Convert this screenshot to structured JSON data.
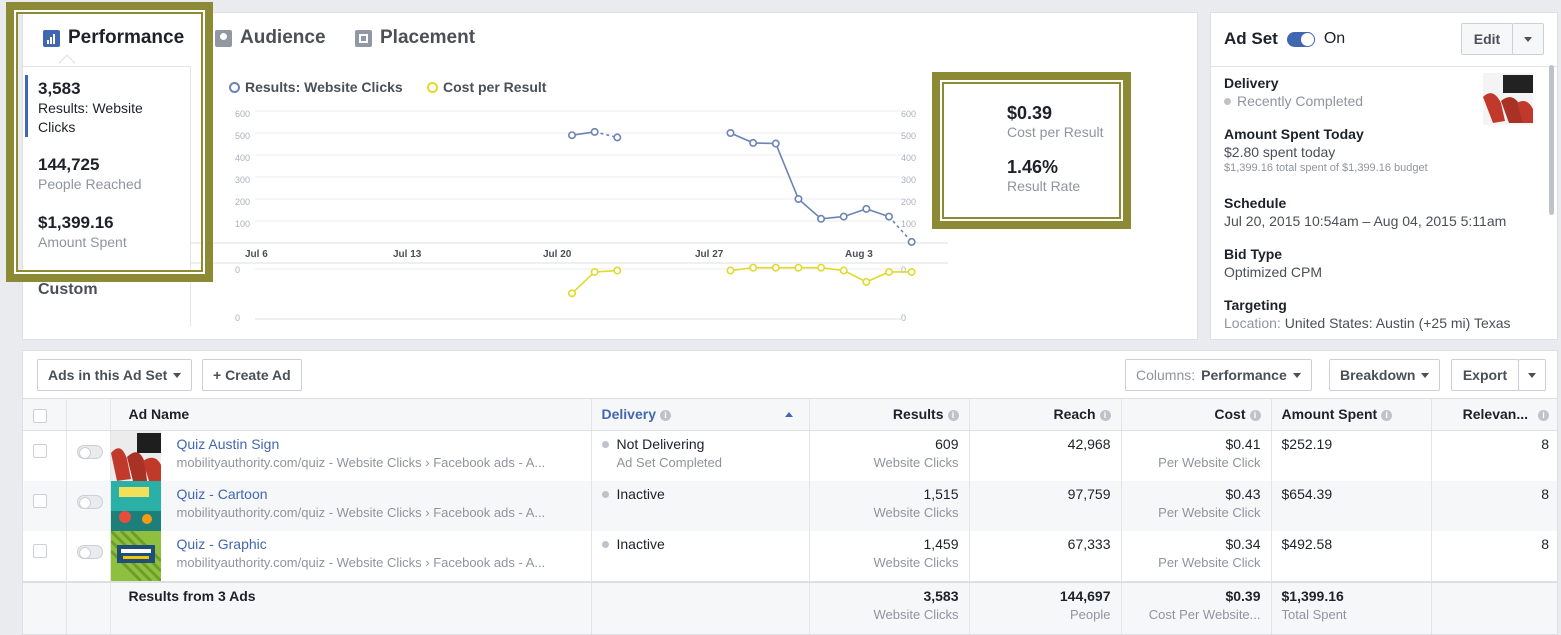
{
  "tabs": [
    {
      "label": "Performance",
      "icon": "bar-chart-icon",
      "active": true
    },
    {
      "label": "Audience",
      "icon": "audience-icon",
      "active": false
    },
    {
      "label": "Placement",
      "icon": "placement-icon",
      "active": false
    }
  ],
  "left_stats": [
    {
      "value": "3,583",
      "label": "Results: Website Clicks"
    },
    {
      "value": "144,725",
      "label": "People Reached"
    },
    {
      "value": "$1,399.16",
      "label": "Amount Spent"
    }
  ],
  "custom_label": "Custom",
  "chart_data": {
    "type": "line",
    "legend": [
      "Results: Website Clicks",
      "Cost per Result"
    ],
    "x_ticks": [
      "Jul 6",
      "Jul 13",
      "Jul 20",
      "Jul 27",
      "Aug 3"
    ],
    "y_ticks": [
      "600",
      "500",
      "400",
      "300",
      "200",
      "100"
    ],
    "lower_ticks": [
      "0",
      "0"
    ],
    "series": [
      {
        "name": "Results: Website Clicks",
        "color": "#6b84b5",
        "points": [
          [
            "Jul 20",
            490
          ],
          [
            "Jul 21",
            505
          ],
          [
            "Jul 22",
            480
          ],
          [
            "Jul 27",
            500
          ],
          [
            "Jul 28",
            455
          ],
          [
            "Jul 29",
            452
          ],
          [
            "Jul 30",
            200
          ],
          [
            "Jul 31",
            110
          ],
          [
            "Aug 1",
            120
          ],
          [
            "Aug 2",
            155
          ],
          [
            "Aug 3",
            120
          ],
          [
            "Aug 4",
            5
          ]
        ]
      },
      {
        "name": "Cost per Result",
        "color": "#e1d92c",
        "points": [
          [
            "Jul 20",
            0.18
          ],
          [
            "Jul 21",
            0.33
          ],
          [
            "Jul 22",
            0.34
          ],
          [
            "Jul 27",
            0.34
          ],
          [
            "Jul 28",
            0.36
          ],
          [
            "Jul 29",
            0.36
          ],
          [
            "Jul 30",
            0.36
          ],
          [
            "Jul 31",
            0.36
          ],
          [
            "Aug 1",
            0.34
          ],
          [
            "Aug 2",
            0.26
          ],
          [
            "Aug 3",
            0.33
          ],
          [
            "Aug 4",
            0.33
          ]
        ]
      }
    ]
  },
  "summary": [
    {
      "value": "$0.39",
      "label": "Cost per Result"
    },
    {
      "value": "1.46%",
      "label": "Result Rate"
    }
  ],
  "adset": {
    "title": "Ad Set",
    "status": "On",
    "edit_label": "Edit",
    "delivery": {
      "heading": "Delivery",
      "value": "Recently Completed"
    },
    "amount_spent_today": {
      "heading": "Amount Spent Today",
      "value": "$2.80 spent today",
      "detail": "$1,399.16 total spent of $1,399.16 budget"
    },
    "schedule": {
      "heading": "Schedule",
      "value": "Jul 20, 2015 10:54am – Aug 04, 2015 5:11am"
    },
    "bid_type": {
      "heading": "Bid Type",
      "value": "Optimized CPM"
    },
    "targeting": {
      "heading": "Targeting",
      "label": "Location:",
      "value": "United States: Austin (+25 mi) Texas"
    }
  },
  "toolbar": {
    "ads_in_set": "Ads in this Ad Set",
    "create_ad": "+ Create Ad",
    "columns_prefix": "Columns:",
    "columns_value": "Performance",
    "breakdown": "Breakdown",
    "export": "Export"
  },
  "table": {
    "headers": {
      "name": "Ad Name",
      "delivery": "Delivery",
      "results": "Results",
      "reach": "Reach",
      "cost": "Cost",
      "amount": "Amount Spent",
      "relevance": "Relevan..."
    },
    "rows": [
      {
        "name": "Quiz Austin Sign",
        "sub": "mobilityauthority.com/quiz - Website Clicks  ›  Facebook ads - A...",
        "delivery": "Not Delivering",
        "delivery_sub": "Ad Set Completed",
        "results": "609",
        "results_sub": "Website Clicks",
        "reach": "42,968",
        "cost": "$0.41",
        "cost_sub": "Per Website Click",
        "amount": "$252.19",
        "relevance": "8"
      },
      {
        "name": "Quiz - Cartoon",
        "sub": "mobilityauthority.com/quiz - Website Clicks  ›  Facebook ads - A...",
        "delivery": "Inactive",
        "delivery_sub": "",
        "results": "1,515",
        "results_sub": "Website Clicks",
        "reach": "97,759",
        "cost": "$0.43",
        "cost_sub": "Per Website Click",
        "amount": "$654.39",
        "relevance": "8"
      },
      {
        "name": "Quiz - Graphic",
        "sub": "mobilityauthority.com/quiz - Website Clicks  ›  Facebook ads - A...",
        "delivery": "Inactive",
        "delivery_sub": "",
        "results": "1,459",
        "results_sub": "Website Clicks",
        "reach": "67,333",
        "cost": "$0.34",
        "cost_sub": "Per Website Click",
        "amount": "$492.58",
        "relevance": "8"
      }
    ],
    "total": {
      "label": "Results from 3 Ads",
      "results": "3,583",
      "results_sub": "Website Clicks",
      "reach": "144,697",
      "reach_sub": "People",
      "cost": "$0.39",
      "cost_sub": "Cost Per Website...",
      "amount": "$1,399.16",
      "amount_sub": "Total Spent"
    }
  },
  "colors": {
    "accent": "#4267b2",
    "highlight": "#8d8a35",
    "series1": "#6b84b5",
    "series2": "#e1d92c"
  }
}
